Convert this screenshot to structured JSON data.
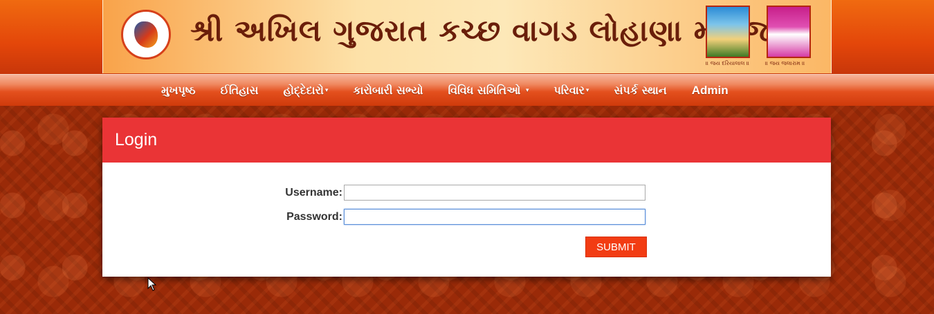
{
  "header": {
    "title": "શ્રી અખિલ ગુજરાત કચ્છ વાગડ લોહાણા મહાજન",
    "deity_captions": [
      "॥ જય દરિયાલાલ ॥",
      "॥ જય જલારામ ॥"
    ]
  },
  "nav": {
    "items": [
      {
        "label": "મુખપૃષ્ઠ",
        "dropdown": false
      },
      {
        "label": "ઈતિહાસ",
        "dropdown": false
      },
      {
        "label": "હોદ્દેદારો",
        "dropdown": true
      },
      {
        "label": "કારોબારી સભ્યો",
        "dropdown": false
      },
      {
        "label": "વિવિધ સમિતિઓ",
        "dropdown": true
      },
      {
        "label": "પરિવાર",
        "dropdown": true
      },
      {
        "label": "સંપર્ક સ્થાન",
        "dropdown": false
      },
      {
        "label": "Admin",
        "dropdown": false
      }
    ]
  },
  "login": {
    "title": "Login",
    "username_label": "Username:",
    "username_value": "",
    "password_label": "Password:",
    "password_value": "",
    "submit_label": "SUBMIT"
  },
  "colors": {
    "header_orange": "#e3460a",
    "panel_header": "#ea3436",
    "submit_button": "#f23c13",
    "page_background": "#9a2a08"
  }
}
